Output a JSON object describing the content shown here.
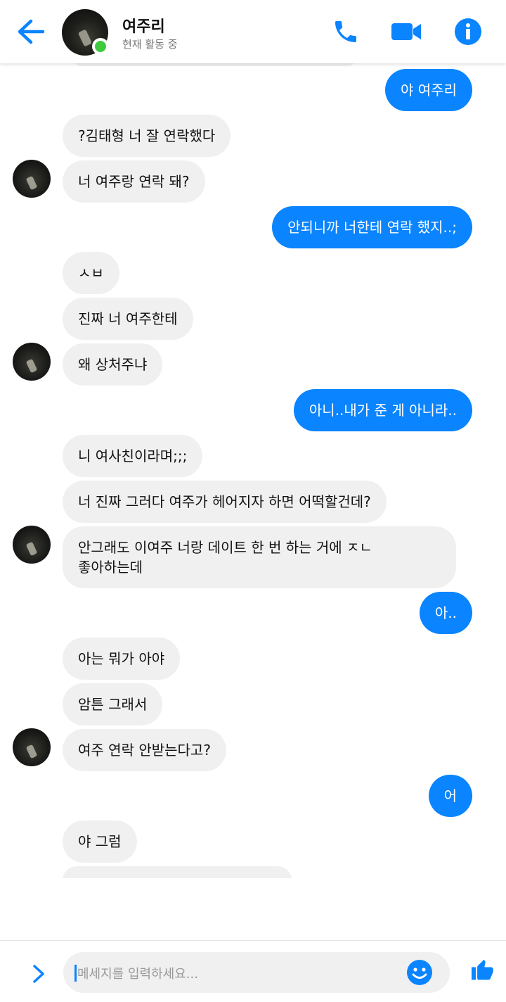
{
  "header": {
    "name": "여주리",
    "status": "현재 활동 중"
  },
  "messages": {
    "m0": "야 여주리",
    "m1": "?김태형 너 잘 연락했다",
    "m2": "너 여주랑 연락 돼?",
    "m3": "안되니까 너한테 연락 했지..;",
    "m4": "ㅅㅂ",
    "m5": "진짜 너 여주한테",
    "m6": "왜 상처주냐",
    "m7": "아니..내가 준 게 아니라..",
    "m8": "니 여사친이라며;;;",
    "m9": "너 진짜 그러다 여주가 헤어지자 하면 어떡할건데?",
    "m10a": "안그래도 이여주 너랑 데이트 한 번 하는 거에 ㅈㄴ",
    "m10b": "좋아하는데",
    "m11": "아..",
    "m12": "아는 뭐가 아야",
    "m13": "암튼 그래서",
    "m14": "여주 연락 안받는다고?",
    "m15": "어",
    "m16": "야 그럼"
  },
  "composer": {
    "placeholder": "메세지를 입력하세요..."
  },
  "colors": {
    "accent": "#0a84ff",
    "incoming_bubble": "#f0f0f0",
    "online": "#3fc93f"
  },
  "icons": [
    "back-arrow-icon",
    "phone-icon",
    "video-camera-icon",
    "info-icon",
    "chevron-right-icon",
    "smiley-icon",
    "thumbs-up-icon"
  ]
}
